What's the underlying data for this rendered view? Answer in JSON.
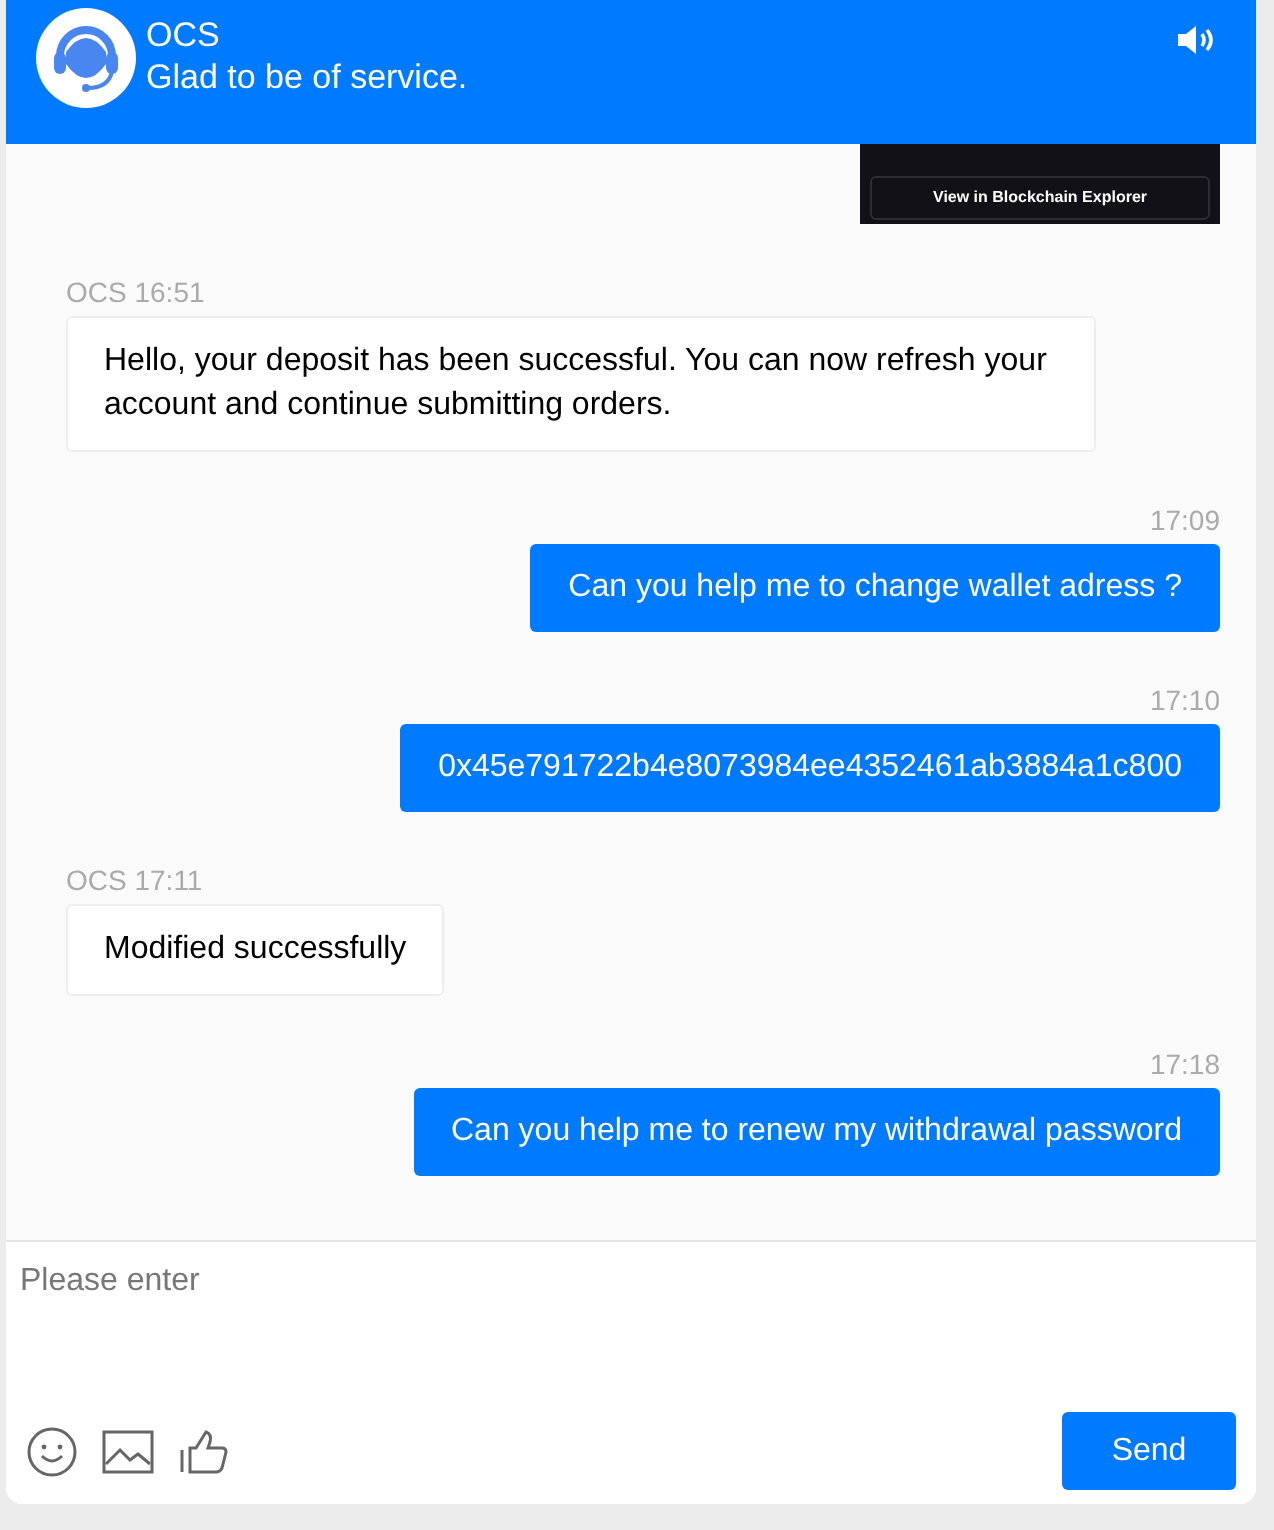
{
  "header": {
    "title": "OCS",
    "subtitle": "Glad to be of service.",
    "sound_on": true
  },
  "messages": [
    {
      "kind": "image",
      "button_label": "View in Blockchain Explorer"
    },
    {
      "kind": "received",
      "meta": "OCS 16:51",
      "text": "Hello, your deposit has been successful. You can now refresh your account and continue submitting orders."
    },
    {
      "kind": "sent",
      "meta": "17:09",
      "text": "Can you help me to change wallet adress ?"
    },
    {
      "kind": "sent",
      "meta": "17:10",
      "text": "0x45e791722b4e8073984ee4352461ab3884a1c800"
    },
    {
      "kind": "received",
      "meta": "OCS 17:11",
      "text": "Modified successfully"
    },
    {
      "kind": "sent",
      "meta": "17:18",
      "text": "Can you help me to renew my withdrawal password"
    }
  ],
  "composer": {
    "placeholder": "Please enter",
    "send_label": "Send"
  }
}
